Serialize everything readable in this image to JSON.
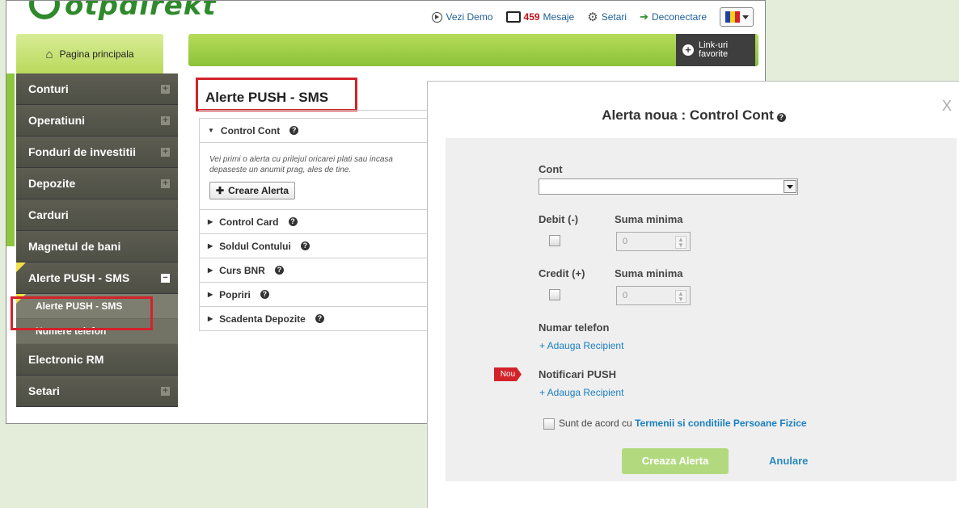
{
  "header": {
    "logo_text": "otpdirekt",
    "demo_label": "Vezi Demo",
    "messages_count": "459",
    "messages_label": "Mesaje",
    "settings_label": "Setari",
    "logout_label": "Deconectare",
    "flag_colors": [
      "#1f3fa5",
      "#f7d117",
      "#d2232a"
    ]
  },
  "home_label": "Pagina principala",
  "favorites_label": "Link-uri favorite",
  "sidebar": {
    "items": [
      {
        "label": "Conturi",
        "expand": "+"
      },
      {
        "label": "Operatiuni",
        "expand": "+"
      },
      {
        "label": "Fonduri de investitii",
        "expand": "+"
      },
      {
        "label": "Depozite",
        "expand": "+"
      },
      {
        "label": "Carduri",
        "expand": ""
      },
      {
        "label": "Magnetul de bani",
        "expand": ""
      },
      {
        "label": "Alerte PUSH - SMS",
        "expand": "−"
      },
      {
        "label": "Electronic RM",
        "expand": ""
      },
      {
        "label": "Setari",
        "expand": "+"
      }
    ],
    "sub_items": [
      "Alerte PUSH - SMS",
      "Numere telefon"
    ]
  },
  "content": {
    "title": "Alerte PUSH - SMS",
    "sections": [
      "Control Cont",
      "Control Card",
      "Soldul Contului",
      "Curs BNR",
      "Popriri",
      "Scadenta Depozite"
    ],
    "description": "Vei primi o alerta cu prilejul oricarei plati sau incasa depaseste un anumit prag, ales de tine.",
    "create_button": "Creare Alerta"
  },
  "modal": {
    "title": "Alerta noua : Control Cont",
    "close": "X",
    "account_label": "Cont",
    "account_value": "",
    "debit_label": "Debit (-)",
    "min_label": "Suma minima",
    "debit_min": "0",
    "credit_label": "Credit (+)",
    "credit_min": "0",
    "phone_label": "Numar telefon",
    "add_recipient": "+ Adauga Recipient",
    "new_badge": "Nou",
    "push_label": "Notificari PUSH",
    "terms_prefix": "Sunt de acord cu",
    "terms_link": "Termenii si conditiile Persoane Fizice",
    "create_label": "Creaza Alerta",
    "cancel_label": "Anulare"
  }
}
